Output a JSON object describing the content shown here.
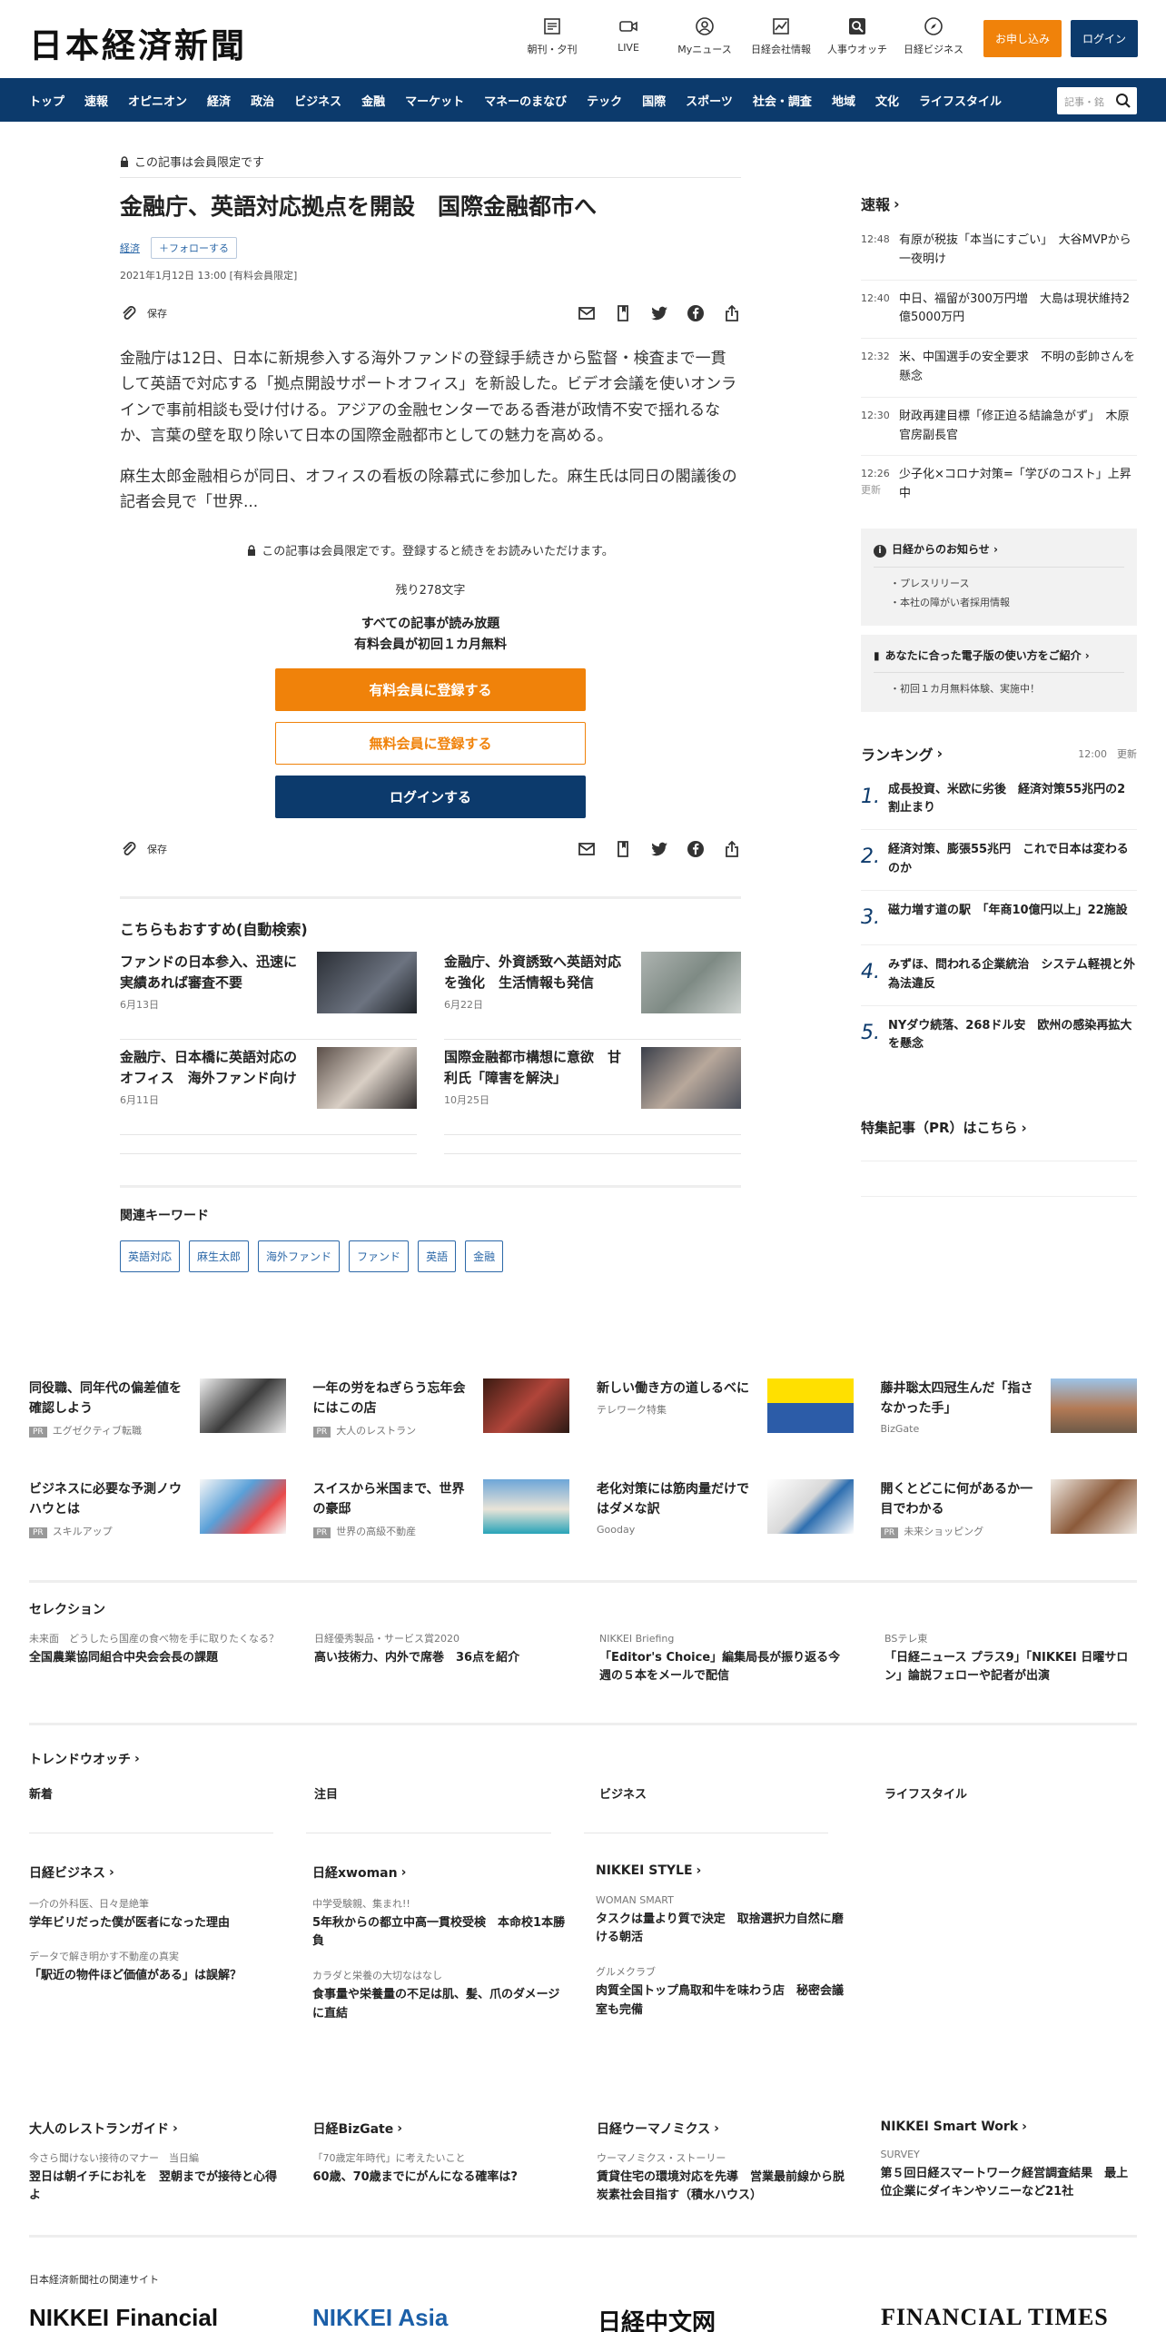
{
  "header": {
    "logo": "日本経済新聞",
    "icons": [
      {
        "label": "朝刊・夕刊",
        "icon": "newspaper-icon"
      },
      {
        "label": "LIVE",
        "icon": "video-icon"
      },
      {
        "label": "Myニュース",
        "icon": "user-icon"
      },
      {
        "label": "日経会社情報",
        "icon": "chart-icon"
      },
      {
        "label": "人事ウオッチ",
        "icon": "search-person-icon"
      },
      {
        "label": "日経ビジネス",
        "icon": "compass-icon"
      }
    ],
    "apply_label": "お申し込み",
    "login_label": "ログイン"
  },
  "nav": {
    "items": [
      "トップ",
      "速報",
      "オピニオン",
      "経済",
      "政治",
      "ビジネス",
      "金融",
      "マーケット",
      "マネーのまなび",
      "テック",
      "国際",
      "スポーツ",
      "社会・調査",
      "地域",
      "文化",
      "ライフスタイル"
    ],
    "search_placeholder": "記事・銘"
  },
  "article": {
    "members_only": "この記事は会員限定です",
    "title": "金融庁、英語対応拠点を開設　国際金融都市へ",
    "category": "経済",
    "follow_label": "フォローする",
    "date": "2021年1月12日 13:00 [有料会員限定]",
    "save_label": "保存",
    "paragraph1": "金融庁は12日、日本に新規参入する海外ファンドの登録手続きから監督・検査まで一貫して英語で対応する「拠点開設サポートオフィス」を新設した。ビデオ会議を使いオンラインで事前相談も受け付ける。アジアの金融センターである香港が政情不安で揺れるなか、言葉の壁を取り除いて日本の国際金融都市としての魅力を高める。",
    "paragraph2": "麻生太郎金融相らが同日、オフィスの看板の除幕式に参加した。麻生氏は同日の閣議後の記者会見で「世界...",
    "paywall_note": "この記事は会員限定です。登録すると続きをお読みいただけます。",
    "remaining": "残り278文字",
    "pitch_line1": "すべての記事が読み放題",
    "pitch_line2": "有料会員が初回１カ月無料",
    "cta_paid": "有料会員に登録する",
    "cta_free": "無料会員に登録する",
    "cta_login": "ログインする"
  },
  "recommend": {
    "heading": "こちらもおすすめ(自動検索)",
    "items": [
      {
        "title": "ファンドの日本参入、迅速に　実績あれば審査不要",
        "date": "6月13日"
      },
      {
        "title": "金融庁、外資誘致へ英語対応を強化　生活情報も発信",
        "date": "6月22日"
      },
      {
        "title": "金融庁、日本橋に英語対応のオフィス　海外ファンド向け",
        "date": "6月11日"
      },
      {
        "title": "国際金融都市構想に意欲　甘利氏「障害を解決」",
        "date": "10月25日"
      }
    ]
  },
  "keywords": {
    "heading": "関連キーワード",
    "items": [
      "英語対応",
      "麻生太郎",
      "海外ファンド",
      "ファンド",
      "英語",
      "金融"
    ]
  },
  "sidebar": {
    "flash_heading": "速報",
    "flash": [
      {
        "time": "12:48",
        "updated": "",
        "title": "有原が税抜「本当にすごい」　大谷MVPから一夜明け"
      },
      {
        "time": "12:40",
        "updated": "",
        "title": "中日、福留が300万円増　大島は現状維持2億5000万円"
      },
      {
        "time": "12:32",
        "updated": "",
        "title": "米、中国選手の安全要求　不明の彭帥さんを懸念"
      },
      {
        "time": "12:30",
        "updated": "",
        "title": "財政再建目標「修正迫る結論急がず」　木原官房副長官"
      },
      {
        "time": "12:26",
        "updated": "更新",
        "title": "少子化×コロナ対策=「学びのコスト」上昇中"
      }
    ],
    "notice1_heading": "日経からのお知らせ",
    "notice1_items": [
      "プレスリリース",
      "本社の障がい者採用情報"
    ],
    "notice2_heading": "あなたに合った電子版の使い方をご紹介",
    "notice2_items": [
      "初回１カ月無料体験、実施中！"
    ],
    "ranking_heading": "ランキング",
    "ranking_time": "12:00",
    "ranking_updated": "更新",
    "ranking": [
      {
        "n": "1.",
        "title": "成長投資、米欧に劣後　経済対策55兆円の2割止まり"
      },
      {
        "n": "2.",
        "title": "経済対策、膨張55兆円　これで日本は変わるのか"
      },
      {
        "n": "3.",
        "title": "磁力増す道の駅　「年商10億円以上」22施設"
      },
      {
        "n": "4.",
        "title": "みずほ、問われる企業統治　システム軽視と外為法違反"
      },
      {
        "n": "5.",
        "title": "NYダウ続落、268ドル安　欧州の感染再拡大を懸念"
      }
    ],
    "special_heading": "特集記事（PR）はこちら"
  },
  "pr": {
    "row1": [
      {
        "title": "同役職、同年代の偏差値を確認しよう",
        "source": "エグゼクティブ転職",
        "pr": true
      },
      {
        "title": "一年の労をねぎらう忘年会にはこの店",
        "source": "大人のレストラン",
        "pr": true
      },
      {
        "title": "新しい働き方の道しるべに",
        "source": "テレワーク特集",
        "pr": false
      },
      {
        "title": "藤井聡太四冠生んだ「指さなかった手」",
        "source": "BizGate",
        "pr": false
      }
    ],
    "row2": [
      {
        "title": "ビジネスに必要な予測ノウハウとは",
        "source": "スキルアップ",
        "pr": true
      },
      {
        "title": "スイスから米国まで、世界の豪邸",
        "source": "世界の高級不動産",
        "pr": true
      },
      {
        "title": "老化対策には筋肉量だけではダメな訳",
        "source": "Gooday",
        "pr": false
      },
      {
        "title": "開くとどこに何があるか一目でわかる",
        "source": "未来ショッピング",
        "pr": true
      }
    ],
    "pr_badge": "PR"
  },
  "selection": {
    "heading": "セレクション",
    "items": [
      {
        "label": "未来面　どうしたら国産の食べ物を手に取りたくなる？",
        "title": "全国農業協同組合中央会会長の課題"
      },
      {
        "label": "日経優秀製品・サービス賞2020",
        "title": "高い技術力、内外で席巻　36点を紹介"
      },
      {
        "label": "NIKKEI Briefing",
        "title": "「Editor's Choice」編集局長が振り返る今週の５本をメールで配信"
      },
      {
        "label": "BSテレ東",
        "title": "「日経ニュース プラス9」「NIKKEI 日曜サロン」論説フェローや記者が出演"
      }
    ]
  },
  "trend": {
    "heading": "トレンドウオッチ",
    "cols": [
      "新着",
      "注目",
      "ビジネス",
      "ライフスタイル"
    ]
  },
  "partners1": [
    {
      "heading": "日経ビジネス",
      "items": [
        {
          "label": "一介の外科医、日々是絶筆",
          "title": "学年ビリだった僕が医者になった理由"
        },
        {
          "label": "データで解き明かす不動産の真実",
          "title": "「駅近の物件ほど価値がある」は誤解？"
        }
      ]
    },
    {
      "heading": "日経xwoman",
      "items": [
        {
          "label": "中学受験親、集まれ!!",
          "title": "5年秋からの都立中高一貫校受検　本命校1本勝負"
        },
        {
          "label": "カラダと栄養の大切なはなし",
          "title": "食事量や栄養量の不足は肌、髪、爪のダメージに直結"
        }
      ]
    },
    {
      "heading": "NIKKEI STYLE",
      "items": [
        {
          "label": "WOMAN SMART",
          "title": "タスクは量より質で決定　取捨選択力自然に磨ける朝活"
        },
        {
          "label": "グルメクラブ",
          "title": "肉質全国トップ鳥取和牛を味わう店　秘密会議室も完備"
        }
      ]
    }
  ],
  "partners2": [
    {
      "heading": "大人のレストランガイド",
      "label": "今さら聞けない接待のマナー　当日編",
      "title": "翌日は朝イチにお礼を　翌朝までが接待と心得よ"
    },
    {
      "heading": "日経BizGate",
      "label": "「70歳定年時代」に考えたいこと",
      "title": "60歳、70歳までにがんになる確率は?"
    },
    {
      "heading": "日経ウーマノミクス",
      "label": "ウーマノミクス・ストーリー",
      "title": "賃貸住宅の環境対応を先導　営業最前線から脱炭素社会目指す（積水ハウス）"
    },
    {
      "heading": "NIKKEI Smart Work",
      "label": "SURVEY",
      "title": "第５回日経スマートワーク経営調査結果　最上位企業にダイキンやソニーなど21社"
    }
  ],
  "footer": {
    "related_heading": "日本経済新聞社の関連サイト",
    "logos": [
      "NIKKEI Financial",
      "NIKKEI Asia",
      "日経中文网",
      "FINANCIAL TIMES"
    ]
  }
}
